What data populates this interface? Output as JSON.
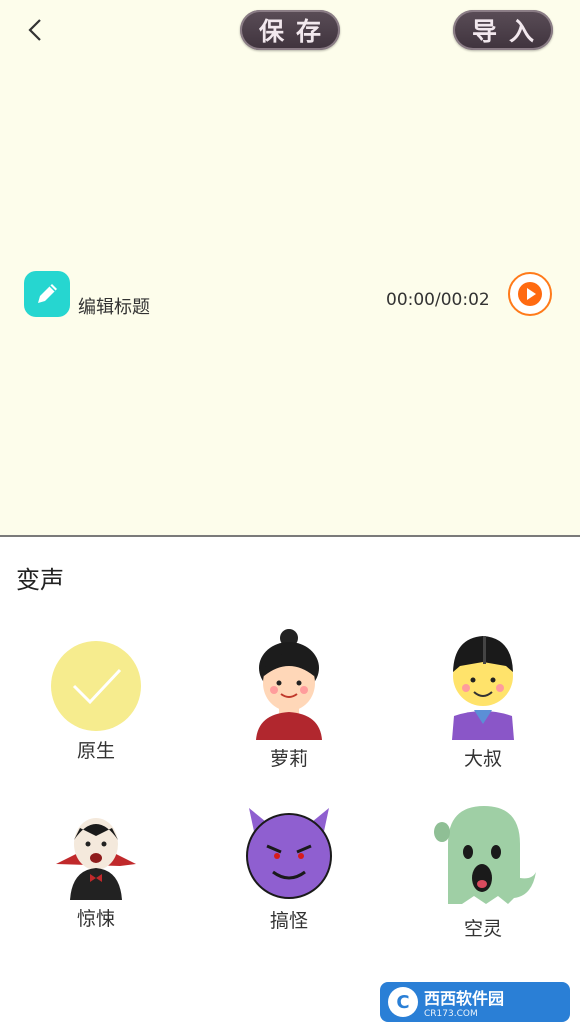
{
  "header": {
    "save_label": "保存",
    "import_label": "导入"
  },
  "recording": {
    "title_label": "编辑标题",
    "time": "00:00/00:02"
  },
  "voice_section": {
    "title": "变声",
    "items": [
      {
        "label": "原生",
        "selected": true
      },
      {
        "label": "萝莉"
      },
      {
        "label": "大叔"
      },
      {
        "label": "惊悚"
      },
      {
        "label": "搞怪"
      },
      {
        "label": "空灵"
      }
    ]
  },
  "watermark": {
    "text": "西西软件园",
    "sub": "CR173.COM"
  },
  "colors": {
    "background": "#fdfdeb",
    "accent_orange": "#ff7a1a",
    "edit_teal": "#26d6d0",
    "selected_yellow": "#f6ec8e"
  }
}
